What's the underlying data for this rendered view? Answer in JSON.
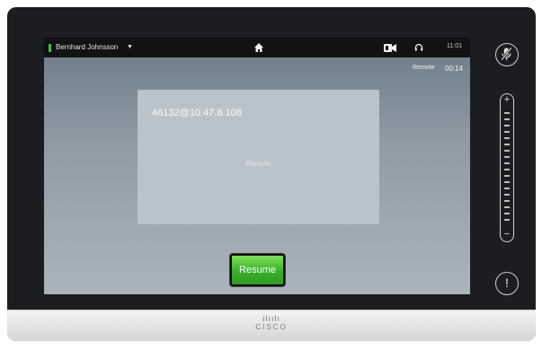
{
  "topbar": {
    "caller_name": "Bernhard Johnsson",
    "caller_caret": "▼",
    "time": "11:01"
  },
  "call": {
    "remote_label": "Remote",
    "duration": "00:14",
    "address": "46132@10.47.8.108",
    "center_label": "Remote"
  },
  "actions": {
    "resume_label": "Resume"
  },
  "side": {
    "volume_plus": "+",
    "volume_minus": "−",
    "alert_symbol": "!"
  },
  "brand": {
    "logo_bars": "ılıılı",
    "logo_word": "CISCO"
  },
  "colors": {
    "status_indicator": "#3cc13c",
    "resume_button": "#38b02a",
    "topbar": "#111214"
  },
  "icons": [
    "home-icon",
    "camera-icon",
    "headset-icon",
    "mute-microphone-icon",
    "alert-icon",
    "cisco-logo"
  ]
}
